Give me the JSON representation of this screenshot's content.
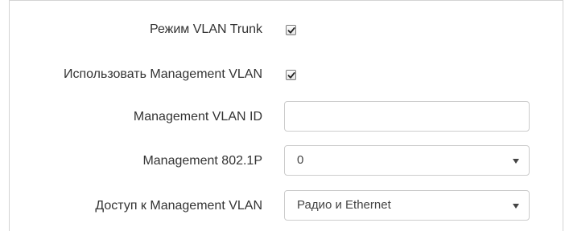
{
  "form": {
    "vlan_trunk": {
      "label": "Режим VLAN Trunk",
      "checked": true
    },
    "use_management_vlan": {
      "label": "Использовать Management VLAN",
      "checked": true
    },
    "management_vlan_id": {
      "label": "Management VLAN ID",
      "value": ""
    },
    "management_8021p": {
      "label": "Management 802.1P",
      "value": "0"
    },
    "management_access": {
      "label": "Доступ к Management VLAN",
      "value": "Радио и Ethernet"
    }
  },
  "icons": {
    "checkmark": "check-icon",
    "dropdown": "chevron-down-icon"
  }
}
